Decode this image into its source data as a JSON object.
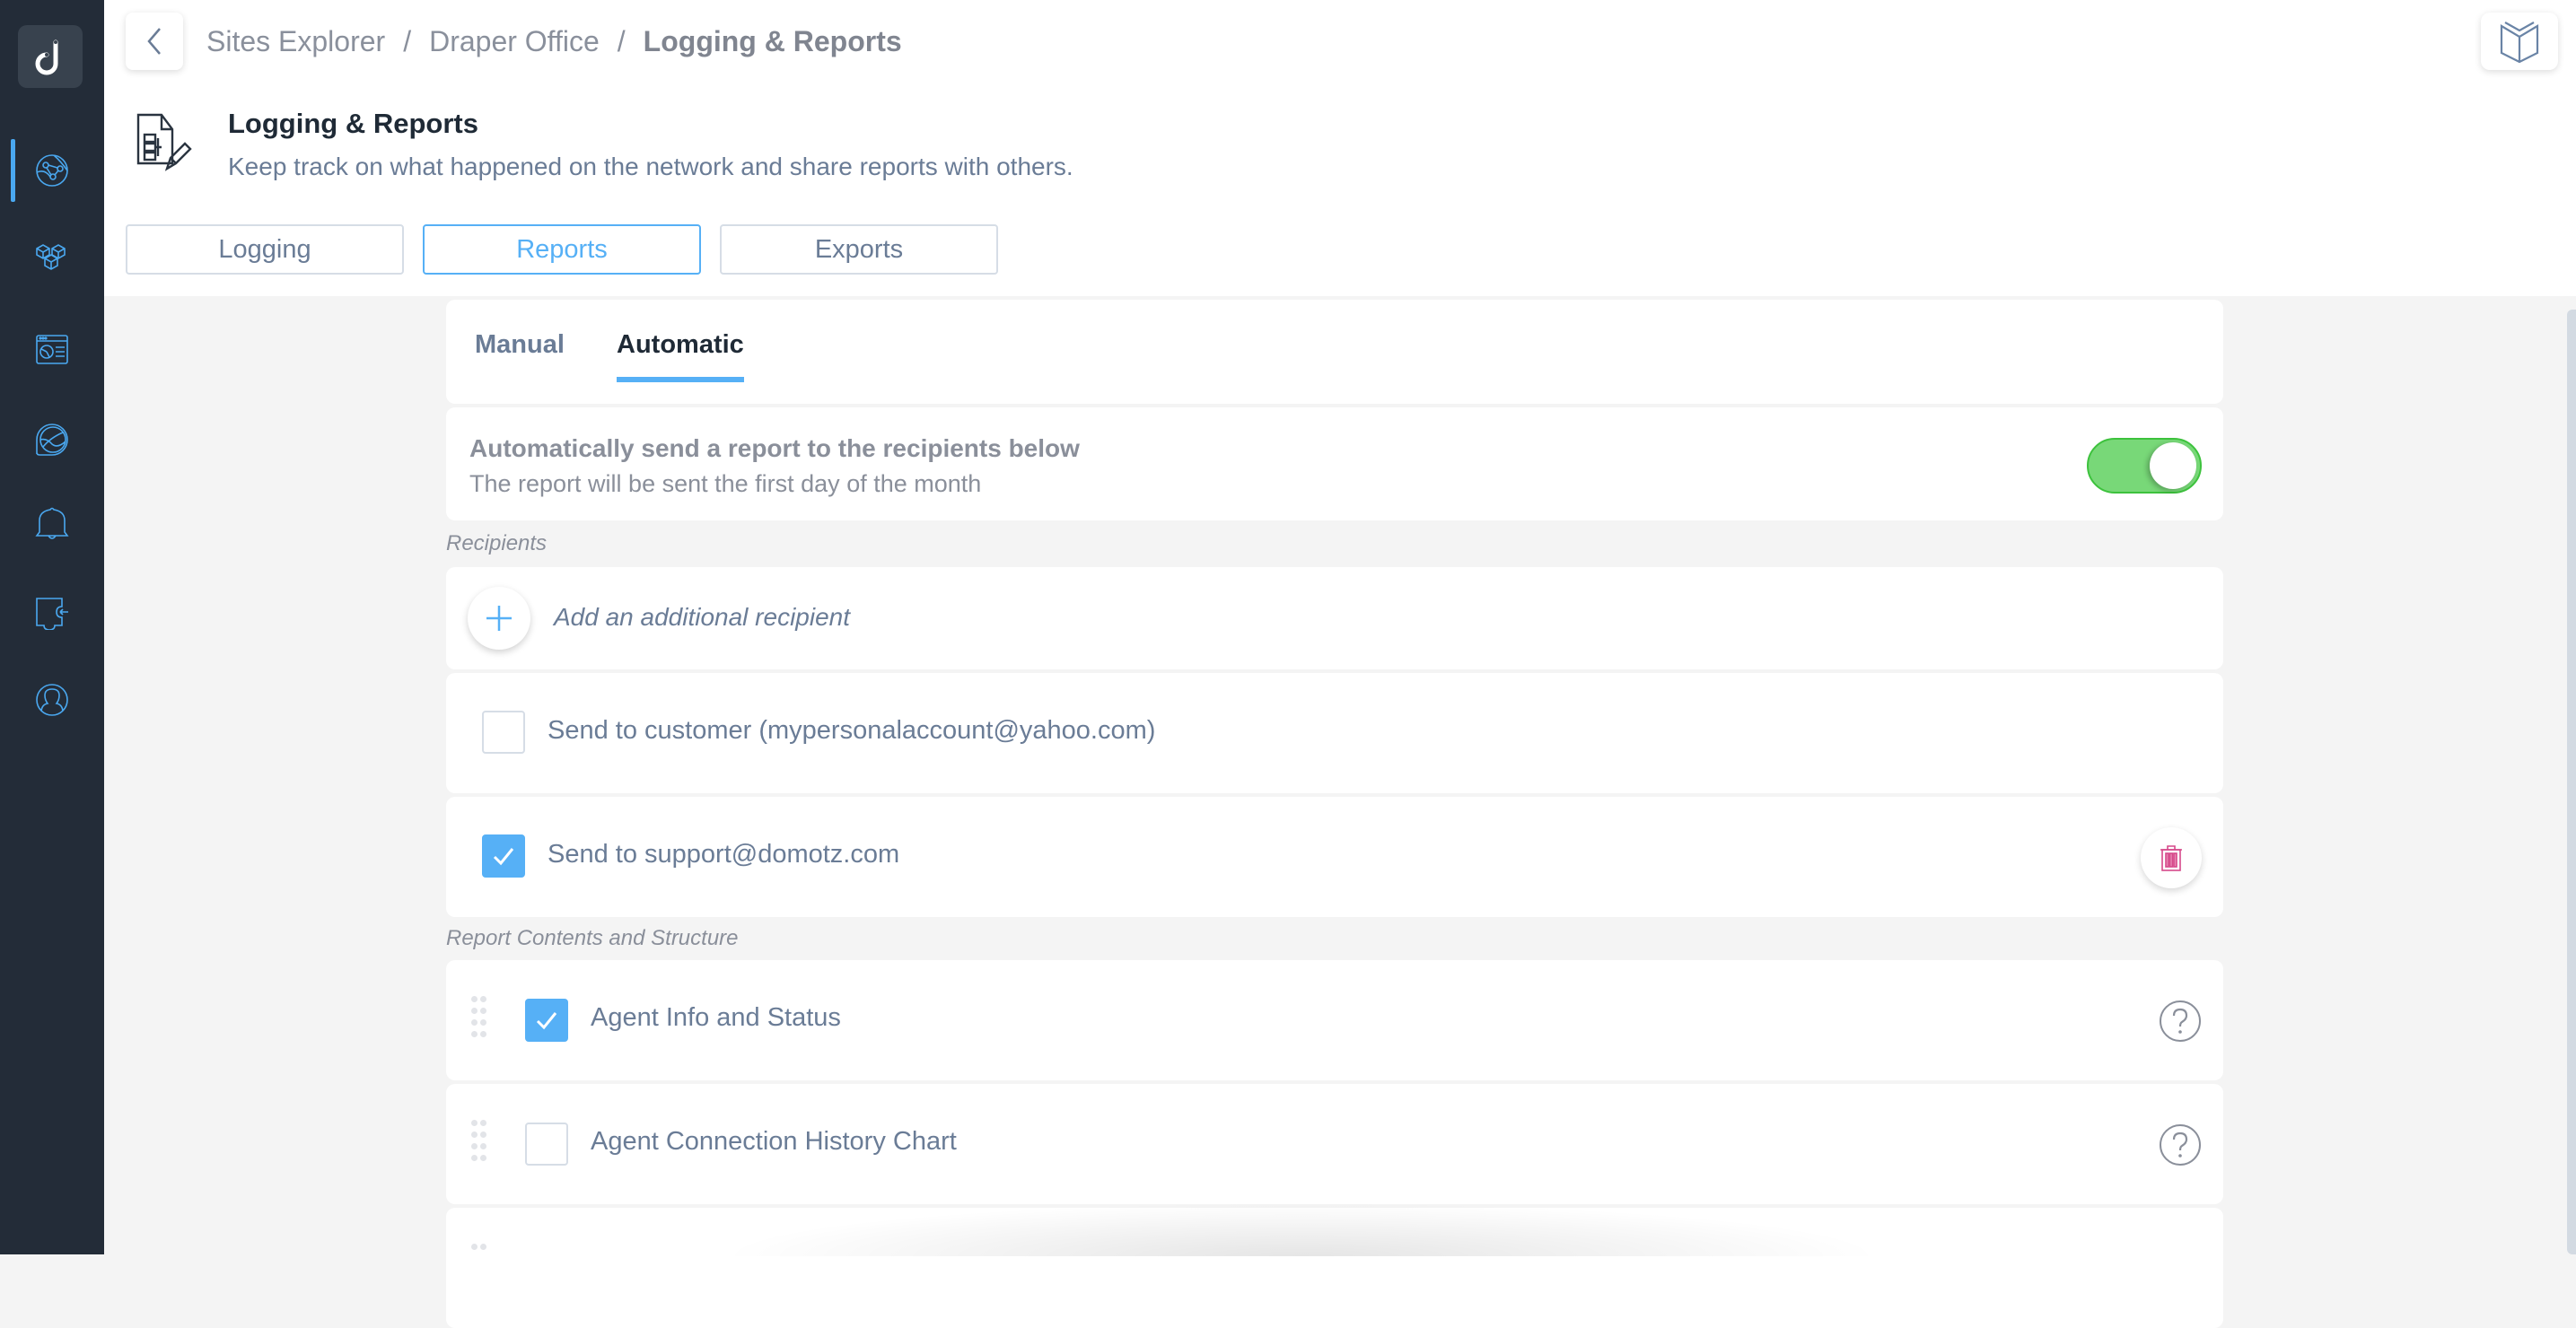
{
  "sidebar": {
    "logo": "domotz-logo",
    "items": [
      {
        "icon": "globe-network-icon",
        "active": true
      },
      {
        "icon": "cubes-icon",
        "active": false
      },
      {
        "icon": "dashboard-window-icon",
        "active": false
      },
      {
        "icon": "speedometer-icon",
        "active": false
      },
      {
        "icon": "bell-icon",
        "active": false
      },
      {
        "icon": "integration-puzzle-icon",
        "active": false
      },
      {
        "icon": "user-profile-icon",
        "active": false
      }
    ]
  },
  "header": {
    "breadcrumb": [
      "Sites Explorer",
      "Draper Office",
      "Logging & Reports"
    ],
    "separator": "/",
    "title": "Logging & Reports",
    "subtitle": "Keep track on what happened on the network and share reports with others.",
    "tabs": [
      {
        "label": "Logging",
        "active": false
      },
      {
        "label": "Reports",
        "active": true
      },
      {
        "label": "Exports",
        "active": false
      }
    ]
  },
  "subtabs": [
    {
      "label": "Manual",
      "active": false
    },
    {
      "label": "Automatic",
      "active": true
    }
  ],
  "automatic": {
    "title": "Automatically send a report to the recipients below",
    "subtitle": "The report will be sent the first day of the month",
    "enabled": true
  },
  "recipients": {
    "section_label": "Recipients",
    "add_label": "Add an additional recipient",
    "items": [
      {
        "label": "Send to customer (mypersonalaccount@yahoo.com)",
        "checked": false,
        "deletable": false
      },
      {
        "label": "Send to support@domotz.com",
        "checked": true,
        "deletable": true
      }
    ]
  },
  "contents": {
    "section_label": "Report Contents and Structure",
    "items": [
      {
        "label": "Agent Info and Status",
        "checked": true
      },
      {
        "label": "Agent Connection History Chart",
        "checked": false
      }
    ]
  },
  "colors": {
    "accent": "#56b0f6",
    "sidebar_bg": "#232c38",
    "toggle_on": "#78d878",
    "danger": "#d6498a"
  }
}
